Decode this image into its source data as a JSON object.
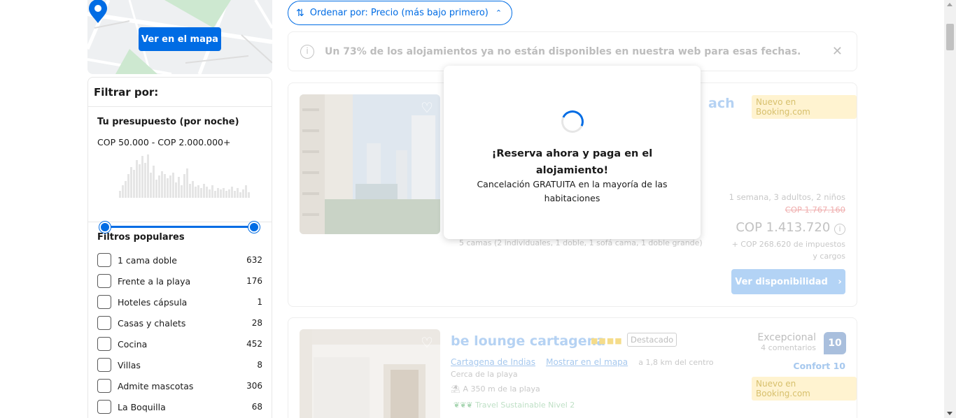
{
  "map": {
    "button_label": "Ver en el mapa"
  },
  "filters": {
    "title": "Filtrar por:",
    "budget": {
      "heading": "Tu presupuesto (por noche)",
      "range": "COP 50.000 - COP 2.000.000+"
    },
    "popular": {
      "heading": "Filtros populares",
      "items": [
        {
          "label": "1 cama doble",
          "count": "632"
        },
        {
          "label": "Frente a la playa",
          "count": "176"
        },
        {
          "label": "Hoteles cápsula",
          "count": "1"
        },
        {
          "label": "Casas y chalets",
          "count": "28"
        },
        {
          "label": "Cocina",
          "count": "452"
        },
        {
          "label": "Villas",
          "count": "8"
        },
        {
          "label": "Admite mascotas",
          "count": "306"
        },
        {
          "label": "La Boquilla",
          "count": "68"
        }
      ]
    }
  },
  "sort": {
    "label": "Ordenar por: Precio (más bajo primero)"
  },
  "notice": {
    "text": "Un 73% de los alojamientos ya no están disponibles en nuestra web para esas fechas."
  },
  "card1": {
    "title_fragment": "ach",
    "badge": "Nuevo en Booking.com",
    "stay": "1 semana, 3 adultos, 2 niños",
    "old_price": "COP 1.767.160",
    "price": "COP 1.413.720",
    "taxes": "+ COP 268.620 de impuestos y cargos",
    "beds": "5 camas (2 individuales, 1 doble, 1 sofá cama, 1 doble grande)",
    "button": "Ver disponibilidad"
  },
  "card2": {
    "title": "be lounge cartagena",
    "featured": "Destacado",
    "city_link": "Cartagena de Indias",
    "map_link": "Mostrar en el mapa",
    "distance": "a 1,8 km del centro",
    "near": "Cerca de la playa",
    "beach": "A 350 m de la playa",
    "sustainable": "Travel Sustainable Nivel 2",
    "rating_word": "Excepcional",
    "reviews": "4 comentarios",
    "score": "10",
    "comfort": "Confort 10",
    "badge": "Nuevo en Booking.com"
  },
  "modal": {
    "title": "¡Reserva ahora y paga en el alojamiento!",
    "subtitle": "Cancelación GRATUITA en la mayoría de las habitaciones"
  },
  "colors": {
    "primary": "#006ce4",
    "badge_bg": "#fff3d0"
  }
}
